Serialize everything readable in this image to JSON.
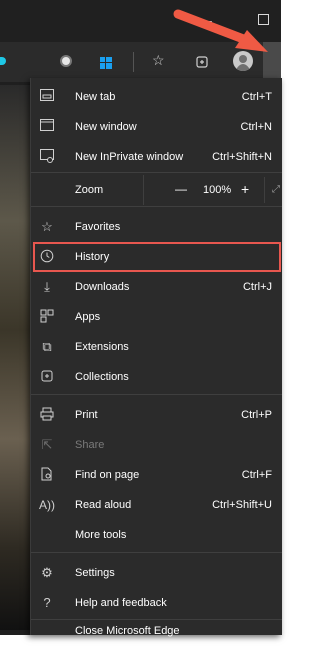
{
  "window": {
    "minimize_glyph": "–"
  },
  "toolbar": {
    "icons": [
      "extension-icon",
      "windows-icon",
      "favorites-icon",
      "collections-icon",
      "profile-avatar"
    ]
  },
  "menu": {
    "new_tab": {
      "label": "New tab",
      "shortcut": "Ctrl+T"
    },
    "new_window": {
      "label": "New window",
      "shortcut": "Ctrl+N"
    },
    "new_inprivate": {
      "label": "New InPrivate window",
      "shortcut": "Ctrl+Shift+N"
    },
    "zoom": {
      "label": "Zoom",
      "minus": "—",
      "value": "100%",
      "plus": "+"
    },
    "favorites": {
      "label": "Favorites"
    },
    "history": {
      "label": "History"
    },
    "downloads": {
      "label": "Downloads",
      "shortcut": "Ctrl+J"
    },
    "apps": {
      "label": "Apps"
    },
    "extensions": {
      "label": "Extensions"
    },
    "collections": {
      "label": "Collections"
    },
    "print": {
      "label": "Print",
      "shortcut": "Ctrl+P"
    },
    "share": {
      "label": "Share"
    },
    "find": {
      "label": "Find on page",
      "shortcut": "Ctrl+F"
    },
    "read_aloud": {
      "label": "Read aloud",
      "shortcut": "Ctrl+Shift+U"
    },
    "more_tools": {
      "label": "More tools"
    },
    "settings": {
      "label": "Settings"
    },
    "help": {
      "label": "Help and feedback"
    },
    "close": {
      "label": "Close Microsoft Edge"
    }
  },
  "colors": {
    "highlight": "#e8574f",
    "menu_bg": "#2b2b2b",
    "text": "#ffffff"
  }
}
